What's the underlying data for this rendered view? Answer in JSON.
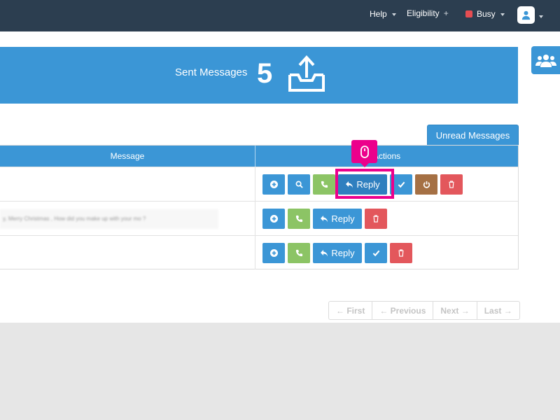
{
  "topbar": {
    "help": "Help",
    "eligibility": "Eligibility",
    "eligibility_plus": "+",
    "status": "Busy",
    "status_color": "#e54d52"
  },
  "banner": {
    "title": "Sent Messages",
    "count": "5"
  },
  "unread_button": "Unread Messages",
  "table": {
    "headers": [
      "Message",
      "Actions"
    ],
    "rows": [
      {
        "message": ""
      },
      {
        "message": "y, Merry Christmas , How did you make up with your mo ?"
      },
      {
        "message": ""
      }
    ],
    "reply_label": "Reply"
  },
  "pagination": {
    "first": "← First",
    "previous": "← Previous",
    "next": "Next →",
    "last": "Last →"
  },
  "colors": {
    "topbar": "#2c3e50",
    "primary": "#3b96d6",
    "green": "#8cc465",
    "brown": "#a57044",
    "red": "#e3575c",
    "highlight": "#ec008c"
  }
}
